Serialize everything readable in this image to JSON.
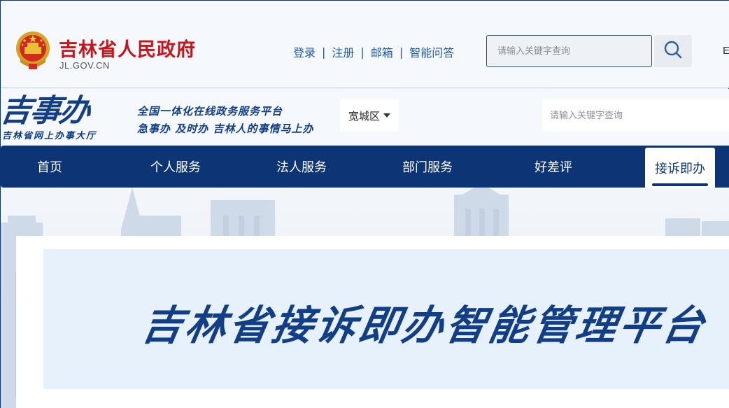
{
  "header": {
    "site_title": "吉林省人民政府",
    "domain": "JL.GOV.CN",
    "links": [
      "登录",
      "注册",
      "邮箱",
      "智能问答"
    ],
    "search_placeholder": "请输入关键字查询",
    "edge_text": "E"
  },
  "portal": {
    "logo": "吉事办",
    "logo_sub": "吉林省网上办事大厅",
    "slogan_1": "全国一体化在线政务服务平台",
    "slogan_2": "急事办 及时办 吉林人的事情马上办",
    "region": "宽城区",
    "search_placeholder": "请输入关键字查询"
  },
  "nav": {
    "items": [
      "首页",
      "个人服务",
      "法人服务",
      "部门服务",
      "好差评",
      "接诉即办"
    ],
    "active": "接诉即办"
  },
  "banner": {
    "title": "吉林省接诉即办智能管理平台"
  },
  "colors": {
    "brand_blue": "#0d3575",
    "title_red": "#c6151b",
    "banner_bg": "#e6f1fb"
  }
}
